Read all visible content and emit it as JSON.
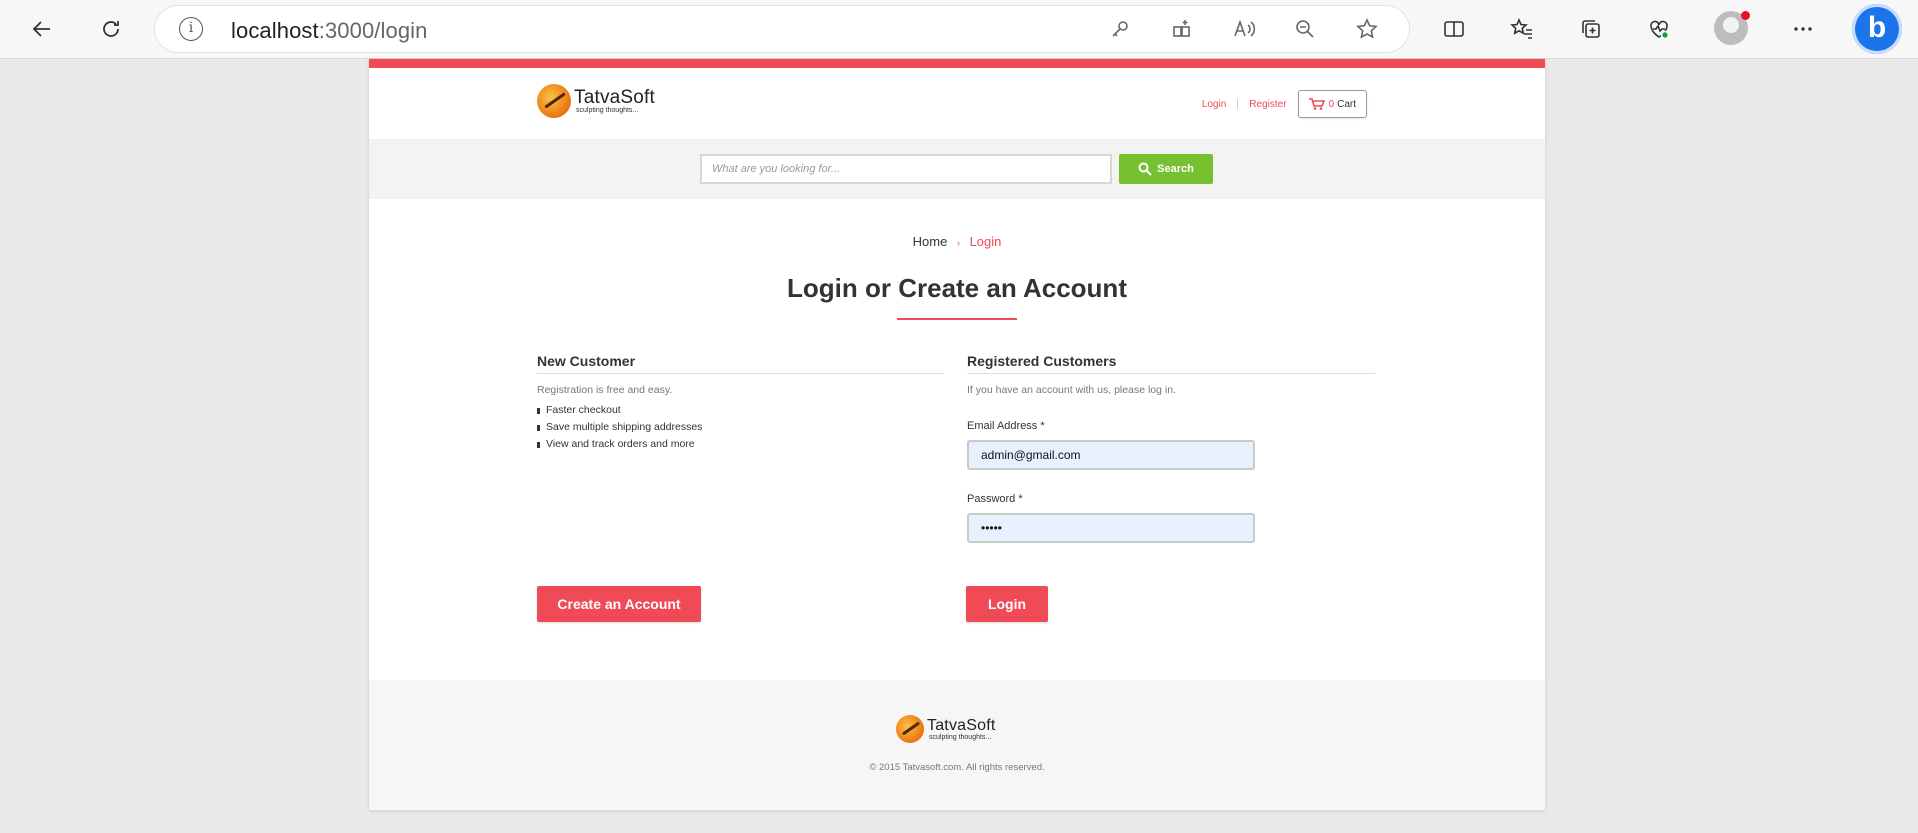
{
  "browser": {
    "url_host": "localhost",
    "url_path": ":3000/login"
  },
  "site": {
    "logo_name": "TatvaSoft",
    "logo_tagline": "sculpting thoughts...",
    "accent_color": "#ef4a56",
    "search_color": "#76c12f"
  },
  "header": {
    "login_link": "Login",
    "register_link": "Register",
    "cart_count": "0",
    "cart_label": "Cart"
  },
  "search": {
    "placeholder": "What are you looking for...",
    "button_label": "Search"
  },
  "breadcrumb": {
    "home": "Home",
    "separator": "›",
    "current": "Login"
  },
  "page_title": "Login or Create an Account",
  "new_customer": {
    "heading": "New Customer",
    "intro": "Registration is free and easy.",
    "benefits": [
      "Faster checkout",
      "Save multiple shipping addresses",
      "View and track orders and more"
    ],
    "button_label": "Create an Account"
  },
  "registered": {
    "heading": "Registered Customers",
    "intro": "If you have an account with us, please log in.",
    "email_label": "Email Address *",
    "email_value": "admin@gmail.com",
    "password_label": "Password *",
    "password_value": "•••••",
    "button_label": "Login"
  },
  "footer": {
    "logo_name": "TatvaSoft",
    "logo_tagline": "sculpting thoughts...",
    "copyright": "© 2015 Tatvasoft.com. All rights reserved."
  }
}
